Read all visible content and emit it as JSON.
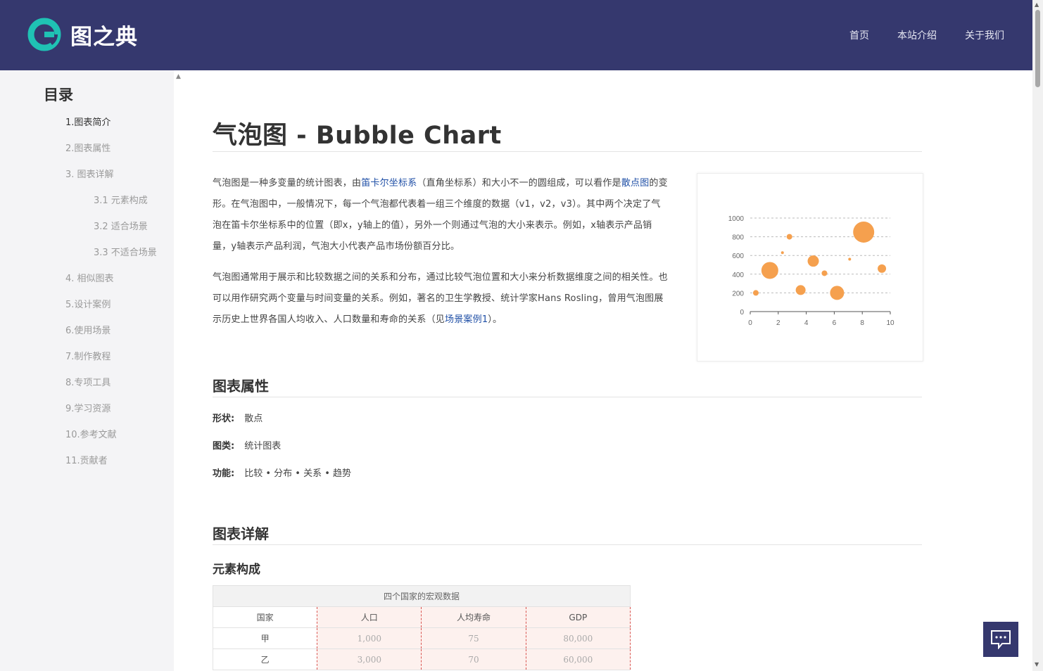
{
  "header": {
    "logo_text": "图之典",
    "nav": [
      "首页",
      "本站介绍",
      "关于我们"
    ]
  },
  "sidebar": {
    "title": "目录",
    "items": [
      {
        "label": "1.图表简介",
        "level": 1,
        "active": true
      },
      {
        "label": "2.图表属性",
        "level": 1
      },
      {
        "label": "3. 图表详解",
        "level": 1
      },
      {
        "label": "3.1 元素构成",
        "level": 2
      },
      {
        "label": "3.2 适合场景",
        "level": 2
      },
      {
        "label": "3.3 不适合场景",
        "level": 2
      },
      {
        "label": "4. 相似图表",
        "level": 1
      },
      {
        "label": "5.设计案例",
        "level": 1
      },
      {
        "label": "6.使用场景",
        "level": 1
      },
      {
        "label": "7.制作教程",
        "level": 1
      },
      {
        "label": "8.专项工具",
        "level": 1
      },
      {
        "label": "9.学习资源",
        "level": 1
      },
      {
        "label": "10.参考文献",
        "level": 1
      },
      {
        "label": "11.贡献者",
        "level": 1
      }
    ]
  },
  "main": {
    "title": "气泡图 - Bubble Chart",
    "intro": {
      "p1_a": "气泡图是一种多变量的统计图表，由",
      "p1_link1": "笛卡尔坐标系",
      "p1_b": "（直角坐标系）和大小不一的圆组成，可以看作是",
      "p1_link2": "散点图",
      "p1_c": "的变形。在气泡图中，一般情况下，每一个气泡都代表着一组三个维度的数据（v1，v2，v3）。其中两个决定了气泡在笛卡尔坐标系中的位置（即x，y轴上的值），另外一个则通过气泡的大小来表示。例如，x轴表示产品销量，y轴表示产品利润，气泡大小代表产品市场份额百分比。",
      "p2_a": "气泡图通常用于展示和比较数据之间的关系和分布，通过比较气泡位置和大小来分析数据维度之间的相关性。也可以用作研究两个变量与时间变量的关系。例如，著名的卫生学教授、统计学家Hans Rosling，曾用气泡图展示历史上世界各国人均收入、人口数量和寿命的关系（见",
      "p2_link": "场景案例1",
      "p2_b": "）。"
    },
    "attr_heading": "图表属性",
    "props": [
      {
        "key": "形状:",
        "value": "散点"
      },
      {
        "key": "图类:",
        "value": "统计图表"
      },
      {
        "key": "功能:",
        "value": "比较 • 分布 • 关系 • 趋势"
      }
    ],
    "detail_heading": "图表详解",
    "elements_heading": "元素构成",
    "table": {
      "caption": "四个国家的宏观数据",
      "headers": [
        "国家",
        "人口",
        "人均寿命",
        "GDP"
      ],
      "rows": [
        [
          "甲",
          "1,000",
          "75",
          "80,000"
        ],
        [
          "乙",
          "3,000",
          "70",
          "60,000"
        ]
      ]
    }
  },
  "chart_data": {
    "type": "scatter",
    "xlim": [
      0,
      10
    ],
    "ylim": [
      0,
      1000
    ],
    "x_ticks": [
      "0",
      "2",
      "4",
      "6",
      "8",
      "10"
    ],
    "y_ticks": [
      "0",
      "200",
      "400",
      "600",
      "800",
      "1000"
    ],
    "color": "#f5a04e",
    "grid": "horizontal dashed",
    "points": [
      {
        "x": 0.4,
        "y": 200,
        "size": 4
      },
      {
        "x": 1.4,
        "y": 440,
        "size": 12
      },
      {
        "x": 2.3,
        "y": 630,
        "size": 2
      },
      {
        "x": 2.8,
        "y": 800,
        "size": 4
      },
      {
        "x": 3.6,
        "y": 230,
        "size": 7
      },
      {
        "x": 4.5,
        "y": 540,
        "size": 8
      },
      {
        "x": 5.3,
        "y": 410,
        "size": 4
      },
      {
        "x": 6.2,
        "y": 200,
        "size": 10
      },
      {
        "x": 7.1,
        "y": 560,
        "size": 2
      },
      {
        "x": 8.1,
        "y": 850,
        "size": 15
      },
      {
        "x": 9.4,
        "y": 460,
        "size": 6
      }
    ]
  }
}
